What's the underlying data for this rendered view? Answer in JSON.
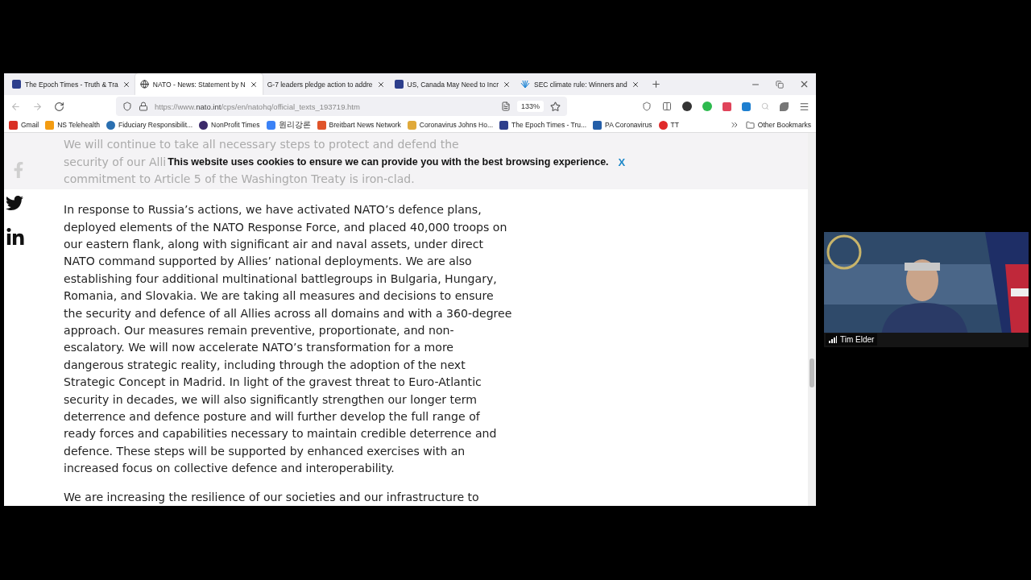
{
  "tabs": [
    {
      "title": "The Epoch Times - Truth & Tra",
      "selected": false
    },
    {
      "title": "NATO - News: Statement by N",
      "selected": true
    },
    {
      "title": "G-7 leaders pledge action to addre",
      "selected": false
    },
    {
      "title": "US, Canada May Need to Incr",
      "selected": false
    },
    {
      "title": "SEC climate rule: Winners and",
      "selected": false
    }
  ],
  "address_bar": {
    "url": "https://www.**nato.int**/cps/en/natohq/official_texts_193719.htm",
    "zoom": "133%"
  },
  "bookmarks": [
    "Gmail",
    "NS Telehealth",
    "Fiduciary Responsibilit...",
    "NonProfit Times",
    "원리강론",
    "Breitbart News Network",
    "Coronavirus Johns Ho...",
    "The Epoch Times - Tru...",
    "PA Coronavirus",
    "TT"
  ],
  "other_bookmarks": "Other Bookmarks",
  "faded_text": {
    "line_1": "We will continue to take all necessary steps to protect and defend the",
    "line_2": "security of our Alli",
    "line_3": "commitment to Article 5 of the Washington Treaty is iron-clad."
  },
  "cookie_banner": {
    "message": "This website uses cookies to ensure we can provide you with the best browsing experience.",
    "close": "X"
  },
  "paragraph": "In response to Russia’s actions, we have activated NATO’s defence plans, deployed elements of the NATO Response Force, and placed 40,000 troops on our eastern flank, along with significant air and naval assets, under direct NATO command supported by Allies’ national deployments. We are also establishing four additional multinational battlegroups in Bulgaria, Hungary, Romania, and Slovakia. We are taking all measures and decisions to ensure the security and defence of all Allies across all domains and with a 360-degree approach.  Our measures remain preventive, proportionate, and non-escalatory. We will now accelerate NATO’s transformation for a more dangerous strategic reality, including through the adoption of the next Strategic Concept in Madrid. In light of the gravest threat to Euro-Atlantic security in decades, we will also significantly strengthen our longer term deterrence and defence posture and will further develop the full range of ready forces and capabilities necessary to maintain credible deterrence and defence. These steps will be supported by enhanced exercises with an increased focus on collective defence and interoperability.",
  "next_paragraph": "We are increasing the resilience of our societies and our infrastructure to",
  "video": {
    "kind": "picture",
    "participant": "Tim Elder"
  }
}
